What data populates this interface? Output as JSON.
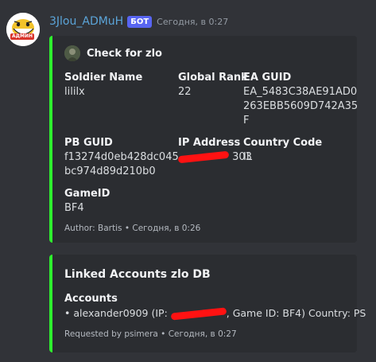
{
  "message": {
    "author": "3Jlou_ADMuH",
    "bot_tag": "БОТ",
    "timestamp": "Сегодня, в 0:27",
    "avatar_label": "АДМИН"
  },
  "embed1": {
    "author_name": "Check for zlo",
    "fields": [
      {
        "name": "Soldier Name",
        "value": "lililx"
      },
      {
        "name": "Global Rank",
        "value": "22"
      },
      {
        "name": "EA GUID",
        "value": "EA_5483C38AE91AD0263EBB5609D742A35F"
      },
      {
        "name": "PB GUID",
        "value": "f13274d0eb428dc045bc974d89d210b0"
      },
      {
        "name": "IP Address",
        "value": "[redacted]"
      },
      {
        "name": "Country Code",
        "value": "IL"
      },
      {
        "name": "GameID",
        "value": "BF4"
      }
    ],
    "ea_guid_lines": [
      "EA_5483C38AE91AD0",
      "263EBB5609D742A35",
      "F"
    ],
    "pb_guid_lines": [
      "f13274d0eb428dc045",
      "bc974d89d210b0"
    ],
    "ip_visible_suffix": "303",
    "footer": "Author: Bartis • Сегодня, в 0:26"
  },
  "embed2": {
    "title": "Linked Accounts zlo DB",
    "field_name": "Accounts",
    "account_prefix": "• alexander0909 (IP: ",
    "account_suffix": ", Game ID: BF4) Country: PS",
    "footer": "Requested by psimera • Сегодня, в 0:27"
  },
  "colors": {
    "background": "#313338",
    "embed_bg": "#2b2d31",
    "embed_accent": "#2ef02e",
    "username": "#5ba4d8",
    "bot_tag": "#5865f2",
    "redaction": "#ff1212"
  }
}
